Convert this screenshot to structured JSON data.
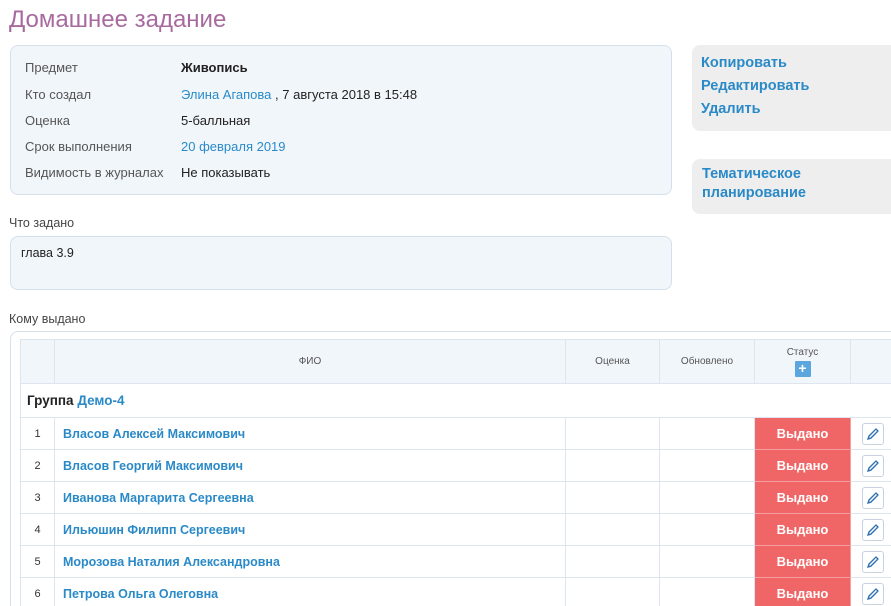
{
  "page": {
    "title": "Домашнее задание"
  },
  "info": {
    "subject_label": "Предмет",
    "subject_value": "Живопись",
    "creator_label": "Кто создал",
    "creator_name": "Элина Агапова",
    "creator_date": ", 7 августа 2018 в 15:48",
    "grade_label": "Оценка",
    "grade_value": "5-балльная",
    "deadline_label": "Срок выполнения",
    "deadline_value": "20 февраля 2019",
    "visibility_label": "Видимость в журналах",
    "visibility_value": "Не показывать"
  },
  "actions": {
    "copy": "Копировать",
    "edit": "Редактировать",
    "delete": "Удалить",
    "planning": "Тематическое планирование"
  },
  "task": {
    "label": "Что задано",
    "text": "глава 3.9"
  },
  "assigned": {
    "label": "Кому выдано",
    "columns": {
      "fio": "ФИО",
      "grade": "Оценка",
      "updated": "Обновлено",
      "status": "Статус"
    },
    "group_prefix": "Группа",
    "group_name": "Демо-4",
    "rows": [
      {
        "num": "1",
        "name": "Власов Алексей Максимович",
        "status": "Выдано"
      },
      {
        "num": "2",
        "name": "Власов Георгий Максимович",
        "status": "Выдано"
      },
      {
        "num": "3",
        "name": "Иванова Маргарита Сергеевна",
        "status": "Выдано"
      },
      {
        "num": "4",
        "name": "Ильюшин Филипп Сергеевич",
        "status": "Выдано"
      },
      {
        "num": "5",
        "name": "Морозова Наталия Александровна",
        "status": "Выдано"
      },
      {
        "num": "6",
        "name": "Петрова Ольга Олеговна",
        "status": "Выдано"
      }
    ]
  },
  "colors": {
    "title": "#a86a9e",
    "link": "#2a8ac8",
    "status_issued": "#f06565",
    "panel_bg": "#f1f6fb"
  },
  "icons": {
    "edit": "pencil-icon",
    "add": "plus-icon"
  }
}
